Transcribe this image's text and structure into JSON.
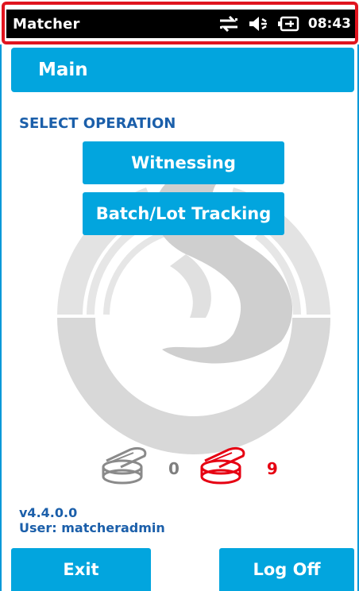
{
  "status_bar": {
    "app_title": "Matcher",
    "time": "08:43",
    "icons": [
      "sync-arrows-icon",
      "speaker-muted-icon",
      "battery-plug-icon"
    ]
  },
  "header": {
    "title": "Main"
  },
  "content": {
    "section_label": "SELECT OPERATION",
    "buttons": [
      {
        "label": "Witnessing"
      },
      {
        "label": "Batch/Lot Tracking"
      }
    ]
  },
  "counts": {
    "grey_count": "0",
    "red_count": "9"
  },
  "footer": {
    "version": "v4.4.0.0",
    "user": "User: matcheradmin"
  },
  "bottom": {
    "exit_label": "Exit",
    "logoff_label": "Log Off"
  },
  "colors": {
    "accent": "#02a5de",
    "label_blue": "#1b5faa",
    "alert_red": "#e60012",
    "highlight_outline": "#e0141e"
  }
}
